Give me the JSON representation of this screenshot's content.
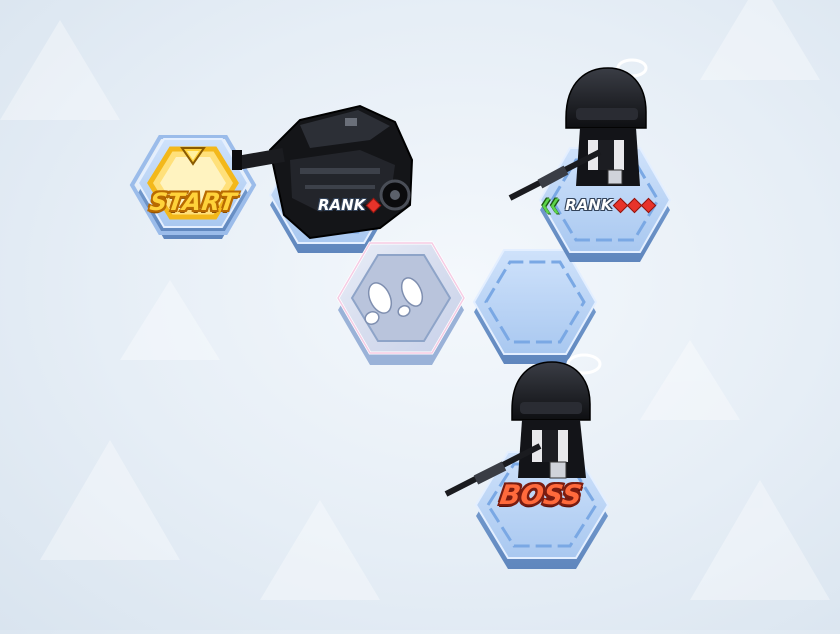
{
  "map": {
    "start_label": "START",
    "boss_label": "BOSS",
    "rank_label": "RANK",
    "rank_tags": [
      {
        "label": "RANK",
        "diamonds": 1,
        "elite_chevron": false
      },
      {
        "label": "RANK",
        "diamonds": 3,
        "elite_chevron": true
      }
    ],
    "icons": [
      "start-marker-icon",
      "footprints-icon",
      "halo-icon"
    ],
    "colors": {
      "tile_blue": "#8fb8ea",
      "start_gold": "#ffd23a",
      "boss_red": "#ff6a3c",
      "rank_diamond": "#e8332a",
      "elite_green": "#5cd44a"
    }
  }
}
